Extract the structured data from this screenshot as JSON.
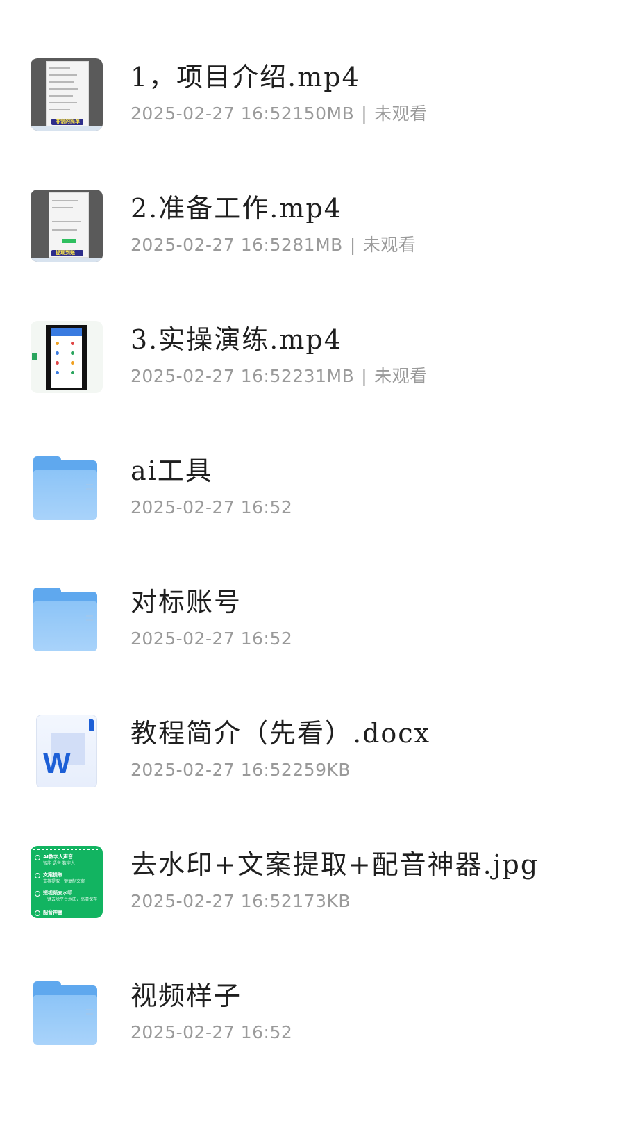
{
  "files": [
    {
      "name": "1，项目介绍.mp4",
      "date": "2025-02-27 16:52",
      "size": "150MB",
      "status": "未观看",
      "type": "video",
      "thumb_caption": "非常的简单"
    },
    {
      "name": "2.准备工作.mp4",
      "date": "2025-02-27 16:52",
      "size": "81MB",
      "status": "未观看",
      "type": "video",
      "thumb_caption": "提现到账"
    },
    {
      "name": "3.实操演练.mp4",
      "date": "2025-02-27 16:52",
      "size": "231MB",
      "status": "未观看",
      "type": "video"
    },
    {
      "name": "ai工具",
      "date": "2025-02-27 16:52",
      "type": "folder"
    },
    {
      "name": "对标账号",
      "date": "2025-02-27 16:52",
      "type": "folder"
    },
    {
      "name": "教程简介（先看）.docx",
      "date": "2025-02-27 16:52",
      "size": "259KB",
      "type": "docx",
      "icon_letter": "W"
    },
    {
      "name": "去水印+文案提取+配音神器.jpg",
      "date": "2025-02-27 16:52",
      "size": "173KB",
      "type": "image",
      "thumb_lines": [
        {
          "title": "AI数字人声音",
          "sub": "智能·语音·数字人"
        },
        {
          "title": "文案提取",
          "sub": "支持提取一键复制文案"
        },
        {
          "title": "短视频去水印",
          "sub": "一键去除平台水印，高清保存"
        },
        {
          "title": "配音神器",
          "sub": ""
        }
      ]
    },
    {
      "name": "视频样子",
      "date": "2025-02-27 16:52",
      "type": "folder"
    }
  ],
  "colors": {
    "folder": "#5fa8ee",
    "word_blue": "#1d5fd6",
    "jpg_green": "#12b461",
    "meta_gray": "#9a9a9a"
  }
}
